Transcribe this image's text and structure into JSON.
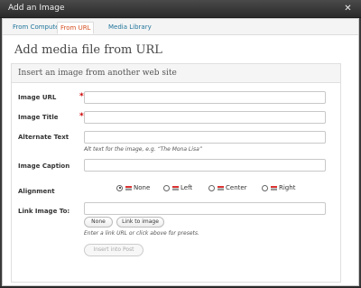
{
  "window": {
    "title": "Add an Image",
    "close_icon": "close-icon"
  },
  "tabs": [
    {
      "label": "From Computer"
    },
    {
      "label": "From URL"
    },
    {
      "label": "Media Library"
    }
  ],
  "heading": "Add media file from URL",
  "panel": {
    "title": "Insert an image from another web site"
  },
  "fields": {
    "image_url": {
      "label": "Image URL",
      "required_mark": "*",
      "value": ""
    },
    "image_title": {
      "label": "Image Title",
      "required_mark": "*",
      "value": ""
    },
    "alternate_text": {
      "label": "Alternate Text",
      "value": "",
      "hint": "Alt text for the image, e.g. “The Mona Lisa”"
    },
    "image_caption": {
      "label": "Image Caption",
      "value": ""
    },
    "alignment": {
      "label": "Alignment",
      "options": [
        {
          "label": "None",
          "selected": true
        },
        {
          "label": "Left",
          "selected": false
        },
        {
          "label": "Center",
          "selected": false
        },
        {
          "label": "Right",
          "selected": false
        }
      ]
    },
    "link_image_to": {
      "label": "Link Image To:",
      "value": "",
      "buttons": [
        "None",
        "Link to image"
      ],
      "hint": "Enter a link URL or click above for presets."
    }
  },
  "insert_button": "Insert into Post",
  "colors": {
    "link": "#21759b",
    "active_tab": "#d54e21",
    "required": "#cc0000"
  }
}
